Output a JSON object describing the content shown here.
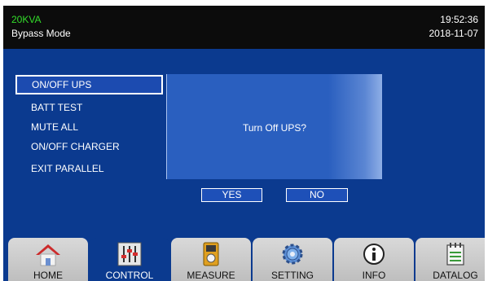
{
  "header": {
    "model": "20KVA",
    "mode": "Bypass Mode",
    "time": "19:52:36",
    "date": "2018-11-07"
  },
  "menu": {
    "selected": "ON/OFF UPS",
    "items": [
      "BATT TEST",
      "MUTE ALL",
      "ON/OFF CHARGER",
      "EXIT PARALLEL"
    ]
  },
  "dialog": {
    "message": "Turn Off UPS?",
    "yes_label": "YES",
    "no_label": "NO"
  },
  "tabs": [
    {
      "label": "HOME",
      "icon": "home-icon"
    },
    {
      "label": "CONTROL",
      "icon": "control-sliders-icon",
      "active": true
    },
    {
      "label": "MEASURE",
      "icon": "meter-icon"
    },
    {
      "label": "SETTING",
      "icon": "gear-icon"
    },
    {
      "label": "INFO",
      "icon": "info-icon"
    },
    {
      "label": "DATALOG",
      "icon": "calendar-log-icon"
    }
  ],
  "colors": {
    "screen_bg": "#0b3a8f",
    "header_bg": "#0c0c0c",
    "model_text": "#33dd2a"
  }
}
